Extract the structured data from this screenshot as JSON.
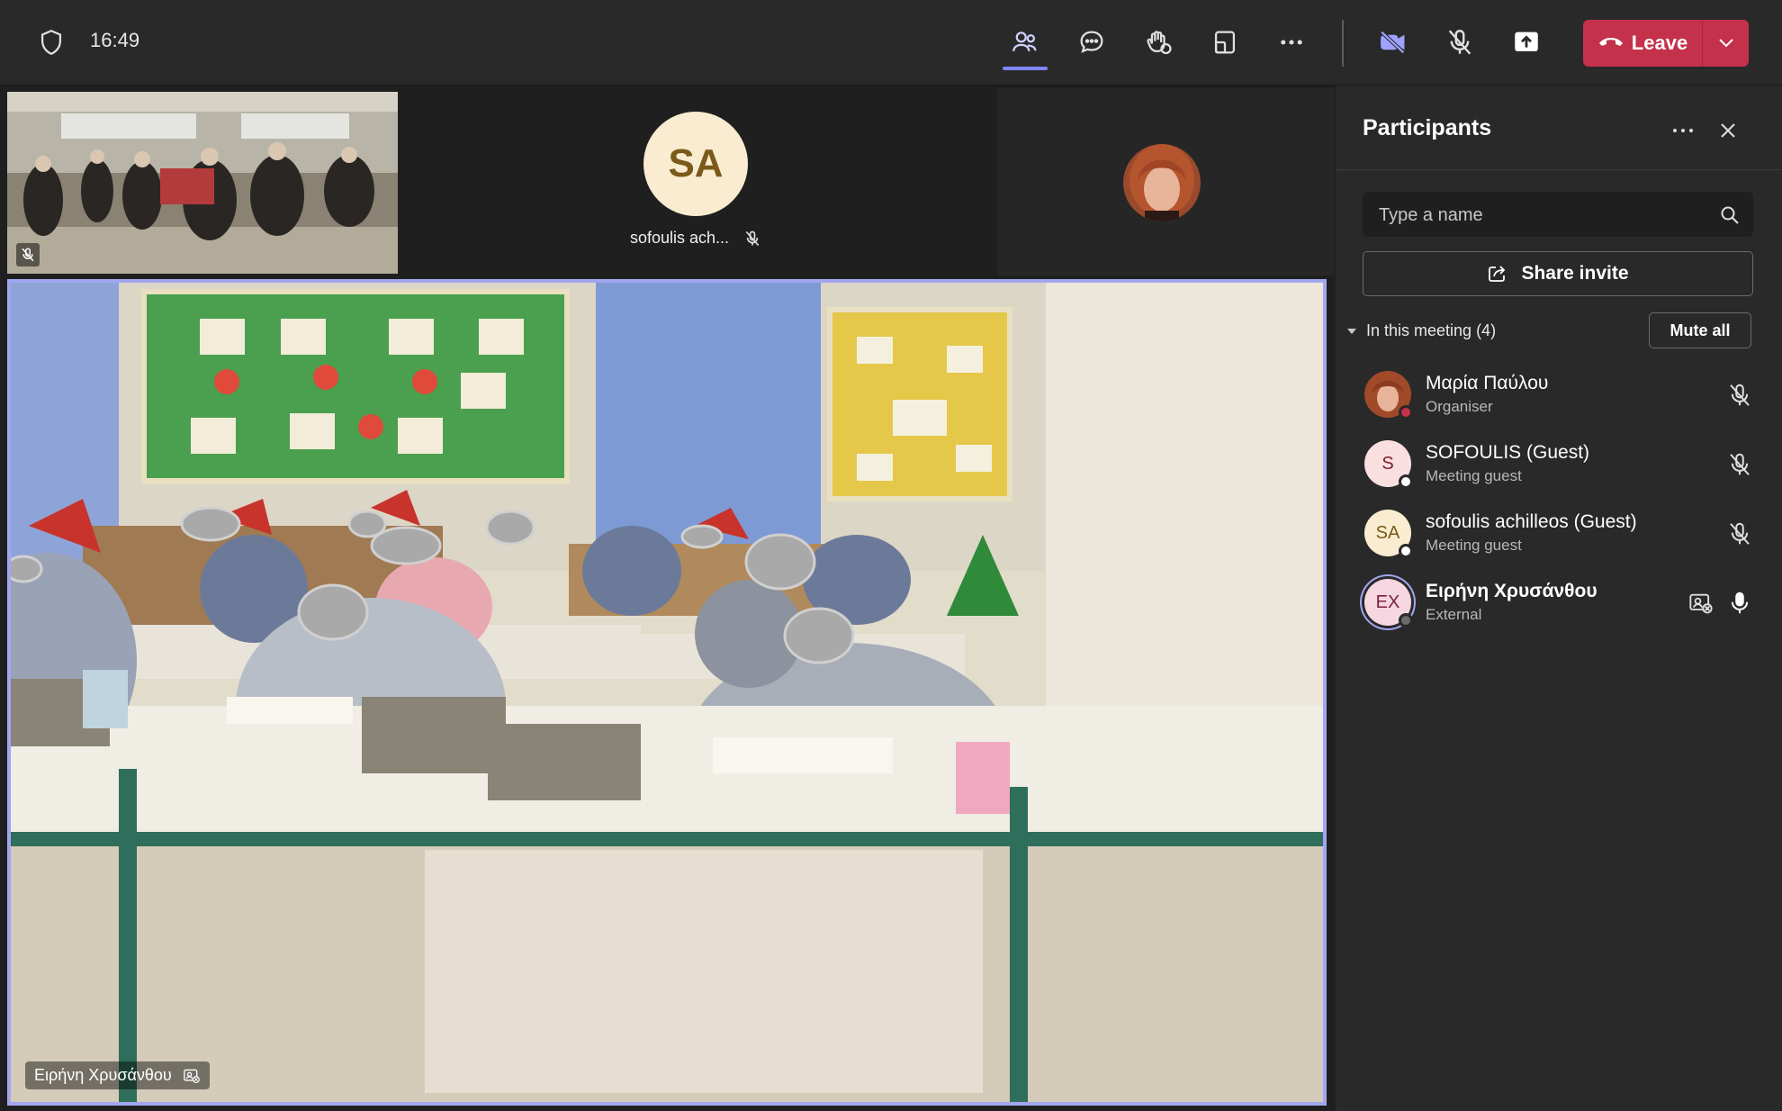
{
  "topbar": {
    "time": "16:49",
    "leave_label": "Leave"
  },
  "tiles": {
    "sa_initials": "SA",
    "sa_name": "sofoulis ach..."
  },
  "main_video": {
    "name": "Ειρήνη Χρυσάνθου"
  },
  "panel": {
    "title": "Participants",
    "search_placeholder": "Type a name",
    "share_label": "Share invite",
    "in_meeting": "In this meeting (4)",
    "mute_all": "Mute all",
    "participants": [
      {
        "name": "Μαρία Παύλου",
        "role": "Organiser"
      },
      {
        "name": "SOFOULIS (Guest)",
        "role": "Meeting guest",
        "initials": "S"
      },
      {
        "name": "sofoulis achilleos (Guest)",
        "role": "Meeting guest",
        "initials": "SA"
      },
      {
        "name": "Ειρήνη Χρυσάνθου",
        "role": "External",
        "initials": "EX"
      }
    ]
  },
  "colors": {
    "leave": "#c4314b",
    "accent": "#7f85f5",
    "panel_bg": "#292929"
  }
}
